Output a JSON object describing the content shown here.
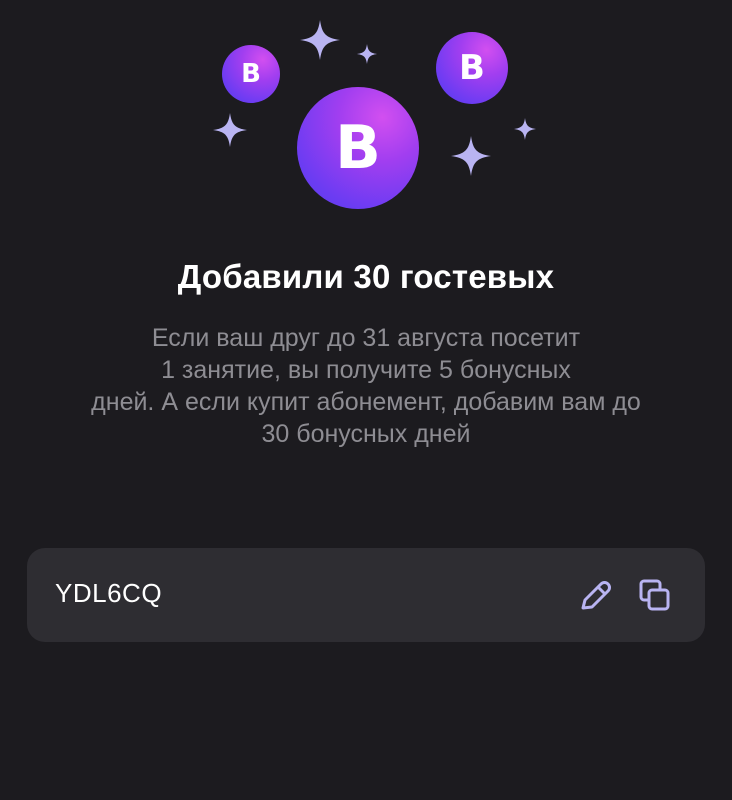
{
  "hero": {
    "coin_letter": "B",
    "icons": [
      "brand-coin-icon",
      "sparkle-icon"
    ],
    "accent_colors": [
      "#d24ff0",
      "#6b3cf2",
      "#b9b4f2"
    ]
  },
  "referral": {
    "title": "Добавили 30 гостевых",
    "description": "Если ваш друг до 31 августа посетит\n1 занятие, вы получите 5 бонусных\nдней. А если купит абонемент, добавим вам до\n30 бонусных дней"
  },
  "code_card": {
    "code": "YDL6CQ",
    "edit_icon": "pencil-icon",
    "copy_icon": "copy-icon"
  }
}
